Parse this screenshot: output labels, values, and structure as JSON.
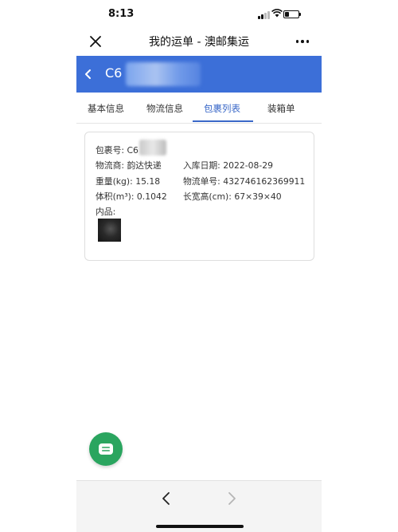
{
  "status_bar": {
    "time": "8:13"
  },
  "nav": {
    "title": "我的运单 - 澳邮集运"
  },
  "header": {
    "order_id_prefix": "C6"
  },
  "tabs": [
    {
      "label": "基本信息",
      "active": false
    },
    {
      "label": "物流信息",
      "active": false
    },
    {
      "label": "包裹列表",
      "active": true
    },
    {
      "label": "装箱单",
      "active": false
    }
  ],
  "package": {
    "package_no_label": "包裹号:",
    "package_no_value": "C6",
    "carrier": "物流商: 韵达快递",
    "inbound_date": "入库日期: 2022-08-29",
    "weight": "重量(kg): 15.18",
    "tracking_no": "物流单号: 432746162369911",
    "volume": "体积(m³): 0.1042",
    "dimensions": "长宽高(cm): 67×39×40",
    "contents_label": "内品:"
  },
  "colors": {
    "header_blue": "#3c6fd8",
    "tab_active": "#3a68c8",
    "fab_green": "#2aa55f"
  },
  "icons": {
    "close": "close-icon",
    "more": "more-icon",
    "back": "chevron-left-icon",
    "chat": "chat-icon",
    "nav_back": "chevron-left-icon",
    "nav_forward": "chevron-right-icon"
  }
}
